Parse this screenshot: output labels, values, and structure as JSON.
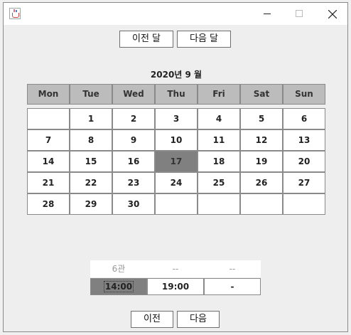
{
  "window": {
    "controls": {
      "minimize_icon": "minimize-icon",
      "maximize_icon": "maximize-icon",
      "close_icon": "close-icon"
    }
  },
  "nav": {
    "prev_month": "이전 달",
    "next_month": "다음 달"
  },
  "calendar": {
    "title": "2020년 9 월",
    "weekdays": [
      "Mon",
      "Tue",
      "Wed",
      "Thu",
      "Fri",
      "Sat",
      "Sun"
    ],
    "weeks": [
      [
        "",
        "1",
        "2",
        "3",
        "4",
        "5",
        "6"
      ],
      [
        "7",
        "8",
        "9",
        "10",
        "11",
        "12",
        "13"
      ],
      [
        "14",
        "15",
        "16",
        "17",
        "18",
        "19",
        "20"
      ],
      [
        "21",
        "22",
        "23",
        "24",
        "25",
        "26",
        "27"
      ],
      [
        "28",
        "29",
        "30",
        "",
        "",
        "",
        ""
      ]
    ],
    "selected_day": "17"
  },
  "showtimes": {
    "header": [
      "6관",
      "--",
      "--"
    ],
    "times": [
      "14:00",
      "19:00",
      "-"
    ],
    "selected_time": "14:00"
  },
  "footer": {
    "prev": "이전",
    "next": "다음"
  }
}
